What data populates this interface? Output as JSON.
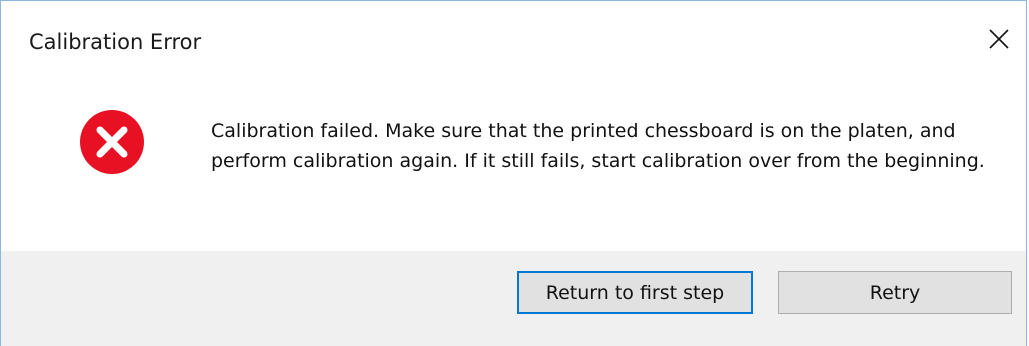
{
  "dialog": {
    "title": "Calibration Error",
    "close_icon": "close-icon",
    "status_icon": "error-icon",
    "message": "Calibration failed. Make sure that the printed chessboard is on the platen, and perform calibration again. If it still fails, start calibration over from the beginning.",
    "buttons": {
      "return_label": "Return to first step",
      "retry_label": "Retry"
    }
  },
  "colors": {
    "error_red": "#e81123",
    "accent_blue": "#0078d7",
    "footer_bg": "#f0f0f0",
    "button_bg": "#e1e1e1"
  }
}
